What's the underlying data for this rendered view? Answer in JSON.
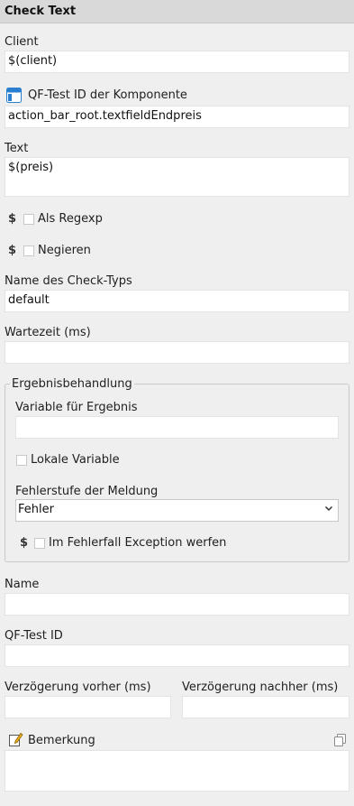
{
  "header": {
    "title": "Check Text"
  },
  "client": {
    "label": "Client",
    "value": "$(client)"
  },
  "component": {
    "label": "QF-Test ID der Komponente",
    "value": "action_bar_root.textfieldEndpreis",
    "icon": "component-window-icon"
  },
  "text": {
    "label": "Text",
    "value": "$(preis)"
  },
  "regexp": {
    "label": "Als Regexp",
    "dollar": "$"
  },
  "negate": {
    "label": "Negieren",
    "dollar": "$"
  },
  "check_type": {
    "label": "Name des Check-Typs",
    "value": "default"
  },
  "timeout": {
    "label": "Wartezeit (ms)",
    "value": ""
  },
  "result_group": {
    "title": "Ergebnisbehandlung",
    "variable_label": "Variable für Ergebnis",
    "variable_value": "",
    "local_label": "Lokale Variable",
    "severity_label": "Fehlerstufe der Meldung",
    "severity_value": "Fehler",
    "exception_label": "Im Fehlerfall Exception werfen",
    "dollar": "$"
  },
  "name": {
    "label": "Name",
    "value": ""
  },
  "qftest_id": {
    "label": "QF-Test ID",
    "value": ""
  },
  "delay_before": {
    "label": "Verzögerung vorher (ms)",
    "value": ""
  },
  "delay_after": {
    "label": "Verzögerung nachher (ms)",
    "value": ""
  },
  "comment": {
    "label": "Bemerkung",
    "value": "",
    "icon": "pencil-note-icon",
    "copy_icon": "copy-icon"
  }
}
